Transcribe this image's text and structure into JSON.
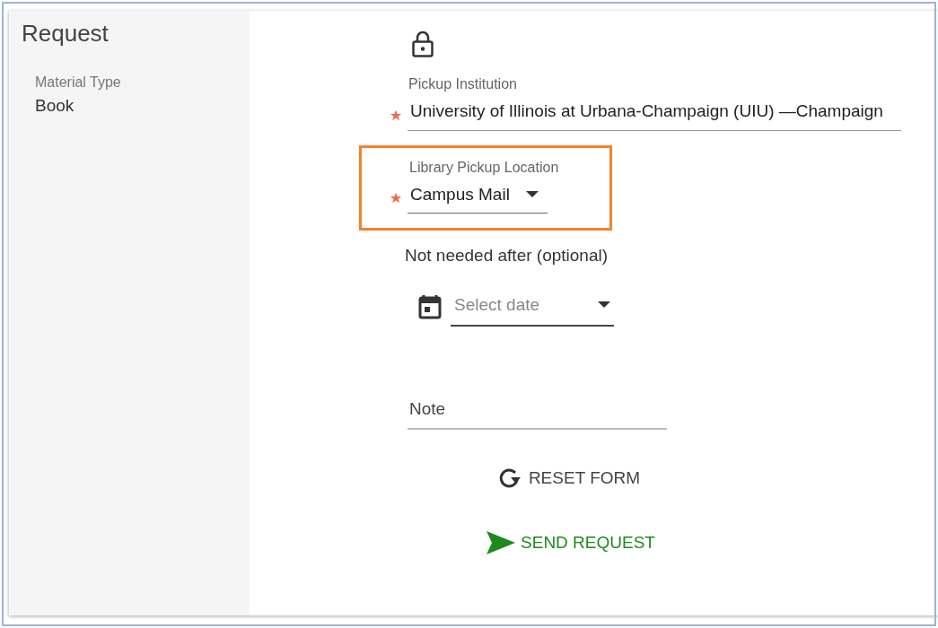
{
  "sidebar": {
    "title": "Request",
    "fields": [
      {
        "label": "Material Type",
        "value": "Book"
      }
    ]
  },
  "form": {
    "fields": [
      {
        "kind": "select",
        "label": "Pickup Institution",
        "value": "University of Illinois at Urbana-Champaign (UIU) —Champaign",
        "required": true
      },
      {
        "kind": "select",
        "label": "Library Pickup Location",
        "value": "Campus Mail",
        "required": true,
        "highlighted": true
      },
      {
        "kind": "date",
        "label": "Not needed after (optional)",
        "placeholder": "Select date"
      },
      {
        "kind": "text",
        "placeholder": "Note"
      }
    ],
    "buttons": [
      {
        "kind": "reset",
        "label": "RESET FORM"
      },
      {
        "kind": "send",
        "label": "SEND REQUEST"
      }
    ]
  }
}
